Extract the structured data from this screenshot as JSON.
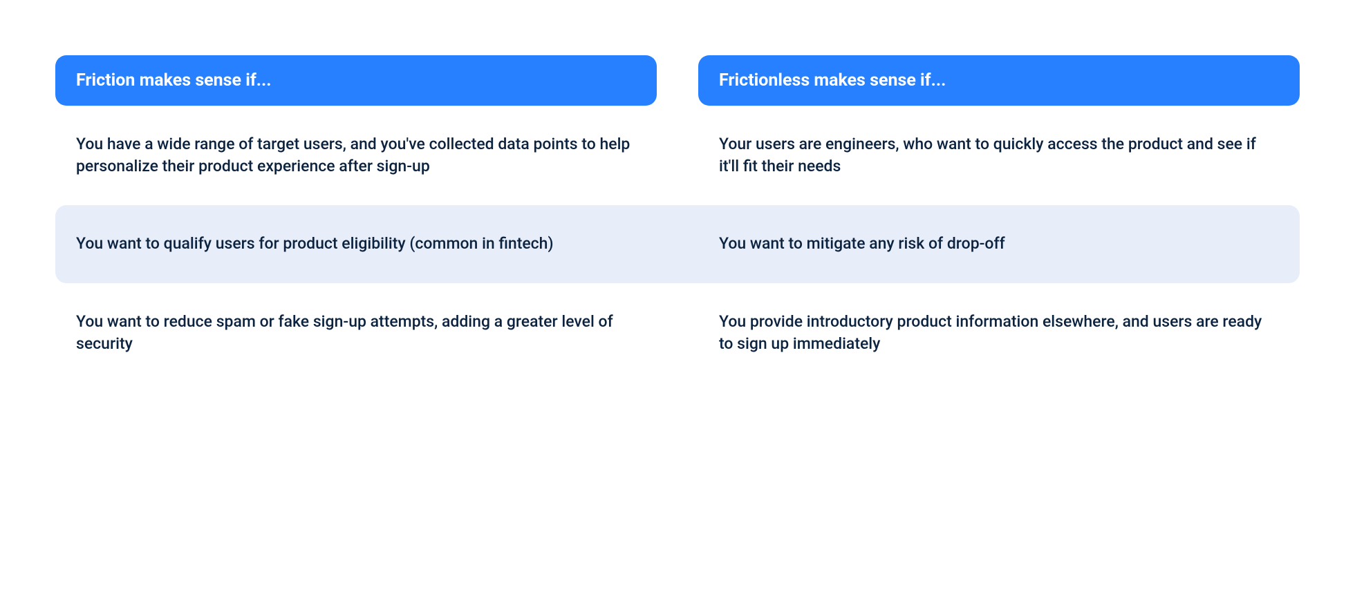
{
  "colors": {
    "header_bg": "#2680ff",
    "header_text": "#ffffff",
    "alt_row_bg": "#e7eefa",
    "body_text": "#0c2340"
  },
  "columns": [
    {
      "header": "Friction makes sense if..."
    },
    {
      "header": "Frictionless makes sense if..."
    }
  ],
  "rows": [
    {
      "alt": false,
      "cells": [
        "You have a wide range of target users, and you've collected data points to help personalize their product experience after sign-up",
        "Your users are engineers, who want to quickly access the product and see if it'll fit their needs"
      ]
    },
    {
      "alt": true,
      "cells": [
        "You want to qualify users for product eligibility (common in fintech)",
        "You want to mitigate any risk of drop-off"
      ]
    },
    {
      "alt": false,
      "cells": [
        "You want to reduce spam or fake sign-up attempts, adding a greater level of security",
        "You provide introductory product information elsewhere, and users are ready to sign up immediately"
      ]
    }
  ]
}
